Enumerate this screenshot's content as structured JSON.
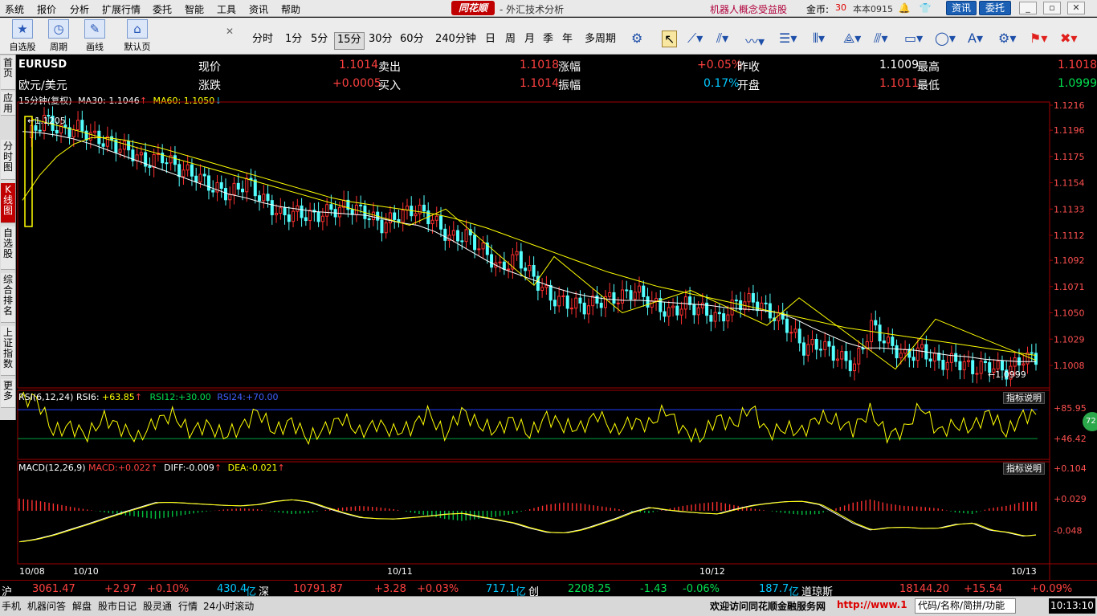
{
  "menubar": {
    "items": [
      "系统",
      "报价",
      "分析",
      "扩展行情",
      "委托",
      "智能",
      "工具",
      "资讯",
      "帮助"
    ],
    "logo": "同花顺",
    "title": "- 外汇技术分析",
    "promo": "机器人概念受益股",
    "coin_label": "金币:",
    "coin_value": "30",
    "version": "本本0915",
    "news_btn": "资讯",
    "trade_btn": "委托"
  },
  "toolbar": {
    "groups": [
      "自选股",
      "周期",
      "画线",
      "默认页"
    ],
    "periods": [
      "分时",
      "1分",
      "5分",
      "15分",
      "30分",
      "60分",
      "240分钟",
      "日",
      "周",
      "月",
      "季",
      "年",
      "多周期"
    ],
    "active_period": "15分"
  },
  "sidebar": {
    "tabs": [
      "首页",
      "应用",
      "分时图",
      "K线图",
      "自选股",
      "综合排名",
      "上证指数",
      "更多"
    ],
    "active_tab": "K线图"
  },
  "quote": {
    "symbol": "EURUSD",
    "name": "欧元/美元",
    "labels": {
      "now": "现价",
      "change": "涨跌",
      "sell": "卖出",
      "buy": "买入",
      "pct": "涨幅",
      "amp": "振幅",
      "prev": "昨收",
      "open": "开盘",
      "high": "最高",
      "low": "最低"
    },
    "now": "1.1014",
    "change": "+0.0005",
    "sell": "1.1018",
    "buy": "1.1014",
    "pct": "+0.05%",
    "amp": "0.17%",
    "prev": "1.1009",
    "open": "1.1011",
    "high": "1.1018",
    "low": "1.0999"
  },
  "ma_line": {
    "period_label": "15分钟(复权)",
    "ma30_label": "MA30:",
    "ma30": "1.1046",
    "ma30_arrow": "↑",
    "ma60_label": "MA60:",
    "ma60": "1.1050",
    "ma60_arrow": "↓"
  },
  "rsi_line": {
    "label": "RSI(6,12,24)",
    "rsi6_label": "RSI6:",
    "rsi6": "+63.85",
    "rsi6_arrow": "↑",
    "rsi12_label": "RSI12:",
    "rsi12": "+30.00",
    "rsi24_label": "RSI24:",
    "rsi24": "+70.00",
    "badge": "72"
  },
  "macd_line": {
    "label": "MACD(12,26,9)",
    "macd_label": "MACD:",
    "macd": "+0.022",
    "macd_arrow": "↑",
    "diff_label": "DIFF:",
    "diff": "-0.009",
    "diff_arrow": "↑",
    "dea_label": "DEA:",
    "dea": "-0.021",
    "dea_arrow": "↑"
  },
  "indicator_button": "指标说明",
  "chart_data": [
    {
      "type": "candlestick",
      "title": "EURUSD 15分钟",
      "y_ticks": [
        "1.1216",
        "1.1196",
        "1.1175",
        "1.1154",
        "1.1133",
        "1.1112",
        "1.1092",
        "1.1071",
        "1.1050",
        "1.1029",
        "1.1008"
      ],
      "ylim": [
        1.099,
        1.1216
      ],
      "x_labels": [
        "10/08",
        "10/10",
        "10/11",
        "10/12",
        "10/13"
      ],
      "marked_high": "←1.1205",
      "marked_low": "←1.0999",
      "close_path": [
        1.119,
        1.1205,
        1.1195,
        1.1198,
        1.119,
        1.1185,
        1.118,
        1.117,
        1.1175,
        1.1165,
        1.116,
        1.115,
        1.1145,
        1.1155,
        1.114,
        1.1128,
        1.113,
        1.1127,
        1.1132,
        1.1135,
        1.113,
        1.112,
        1.1128,
        1.1133,
        1.1125,
        1.111,
        1.1112,
        1.11,
        1.1085,
        1.1095,
        1.1078,
        1.1062,
        1.1058,
        1.1055,
        1.106,
        1.1062,
        1.1068,
        1.1058,
        1.105,
        1.1057,
        1.1052,
        1.1045,
        1.1058,
        1.106,
        1.105,
        1.104,
        1.1022,
        1.1025,
        1.1015,
        1.1008,
        1.104,
        1.1025,
        1.1015,
        1.102,
        1.101,
        1.1012,
        1.1005,
        1.1008,
        1.1003,
        1.1014
      ],
      "ma30_path": [
        1.1195,
        1.1194,
        1.1192,
        1.1189,
        1.1185,
        1.118,
        1.1175,
        1.117,
        1.1165,
        1.116,
        1.1155,
        1.115,
        1.1145,
        1.1142,
        1.1138,
        1.1135,
        1.1133,
        1.1131,
        1.113,
        1.1129,
        1.1128,
        1.1125,
        1.1122,
        1.112,
        1.1115,
        1.1108,
        1.11,
        1.1092,
        1.1085,
        1.108,
        1.1075,
        1.107,
        1.1066,
        1.1063,
        1.1061,
        1.106,
        1.106,
        1.1059,
        1.1058,
        1.1057,
        1.1056,
        1.1054,
        1.1053,
        1.1052,
        1.105,
        1.1045,
        1.1038,
        1.1032,
        1.1026,
        1.1022,
        1.1022,
        1.1021,
        1.102,
        1.1018,
        1.1016,
        1.1015,
        1.1013,
        1.1012,
        1.1011,
        1.1011
      ],
      "ma60_path": [
        1.114,
        1.116,
        1.1175,
        1.1185,
        1.119,
        1.119,
        1.1188,
        1.1185,
        1.1182,
        1.1178,
        1.1174,
        1.117,
        1.1166,
        1.1162,
        1.1158,
        1.1154,
        1.115,
        1.1146,
        1.1142,
        1.1139,
        1.1137,
        1.1135,
        1.1133,
        1.1131,
        1.1129,
        1.1126,
        1.1122,
        1.1118,
        1.1113,
        1.1108,
        1.1103,
        1.1098,
        1.1093,
        1.1088,
        1.1083,
        1.1079,
        1.1075,
        1.1071,
        1.1068,
        1.1065,
        1.1062,
        1.1059,
        1.1056,
        1.1053,
        1.105,
        1.1047,
        1.1044,
        1.1041,
        1.1038,
        1.1036,
        1.1034,
        1.1032,
        1.103,
        1.1028,
        1.1026,
        1.1024,
        1.1022,
        1.102,
        1.1018,
        1.1016
      ]
    },
    {
      "type": "line",
      "title": "RSI(6,12,24)",
      "y_ticks": [
        "+85.95",
        "+46.42"
      ],
      "ylim": [
        0,
        100
      ],
      "series": [
        {
          "name": "RSI6",
          "values": [
            88,
            88,
            40,
            48,
            35,
            60,
            45,
            30,
            55,
            65,
            40,
            50,
            35,
            45,
            70,
            40,
            55,
            30,
            45,
            60,
            38,
            52,
            40,
            45,
            68,
            35,
            70,
            50,
            42,
            58,
            36,
            62,
            48,
            45,
            66,
            40,
            55,
            50,
            72,
            42,
            30,
            60,
            50,
            76,
            38,
            45,
            40,
            62,
            55,
            44,
            70,
            35,
            42,
            78,
            40,
            50,
            46,
            68,
            38,
            64
          ]
        }
      ]
    },
    {
      "type": "bar",
      "title": "MACD(12,26,9)",
      "y_ticks": [
        "+0.104",
        "+0.029",
        "-0.048"
      ],
      "ylim": [
        -0.13,
        0.12
      ],
      "values": [
        0.03,
        0.025,
        0.018,
        0.01,
        0.003,
        -0.004,
        -0.01,
        -0.015,
        -0.02,
        -0.015,
        -0.008,
        -0.002,
        0.003,
        0.006,
        0.004,
        -0.003,
        -0.008,
        -0.006,
        0.002,
        0.008,
        0.012,
        0.009,
        0.004,
        -0.004,
        -0.012,
        -0.02,
        -0.025,
        -0.02,
        -0.015,
        -0.008,
        0.004,
        0.015,
        0.02,
        0.018,
        0.012,
        0.006,
        -0.002,
        -0.006,
        0.004,
        0.012,
        0.018,
        0.022,
        0.014,
        0.006,
        0.0,
        -0.006,
        -0.01,
        -0.008,
        0.006,
        0.02,
        0.028,
        0.018,
        0.012,
        0.01,
        0.006,
        -0.004,
        -0.008,
        0.006,
        0.012,
        0.022
      ]
    }
  ],
  "ticker": {
    "sh_label": "沪",
    "sh_value": "3061.47",
    "sh_change": "+2.97",
    "sh_pct": "+0.10%",
    "sh_vol": "430.4",
    "sh_vol_unit": "亿",
    "sz_label": "深",
    "sz_value": "10791.87",
    "sz_change": "+3.28",
    "sz_pct": "+0.03%",
    "sz_vol": "717.1",
    "sz_vol_unit": "亿",
    "cy_label": "创",
    "cy_value": "2208.25",
    "cy_change": "-1.43",
    "cy_pct": "-0.06%",
    "cy_vol": "187.7",
    "cy_vol_unit": "亿",
    "dj_label": "道琼斯",
    "dj_value": "18144.20",
    "dj_change": "+15.54",
    "dj_pct": "+0.09%"
  },
  "statusbar": {
    "items": [
      "手机",
      "机器问答",
      "解盘",
      "股市日记",
      "股灵通",
      "行情",
      "24小时滚动"
    ],
    "welcome": "欢迎访问同花顺金融服务网",
    "url": "http://www.1",
    "search_placeholder": "代码/名称/简拼/功能",
    "clock": "10:13:10"
  },
  "colors": {
    "up": "#ff3030",
    "down": "#54ffff",
    "ma30": "#ffffff",
    "ma60": "#ffff00",
    "rsi_hi": "#2040ff",
    "rsi_lo": "#00a040"
  }
}
